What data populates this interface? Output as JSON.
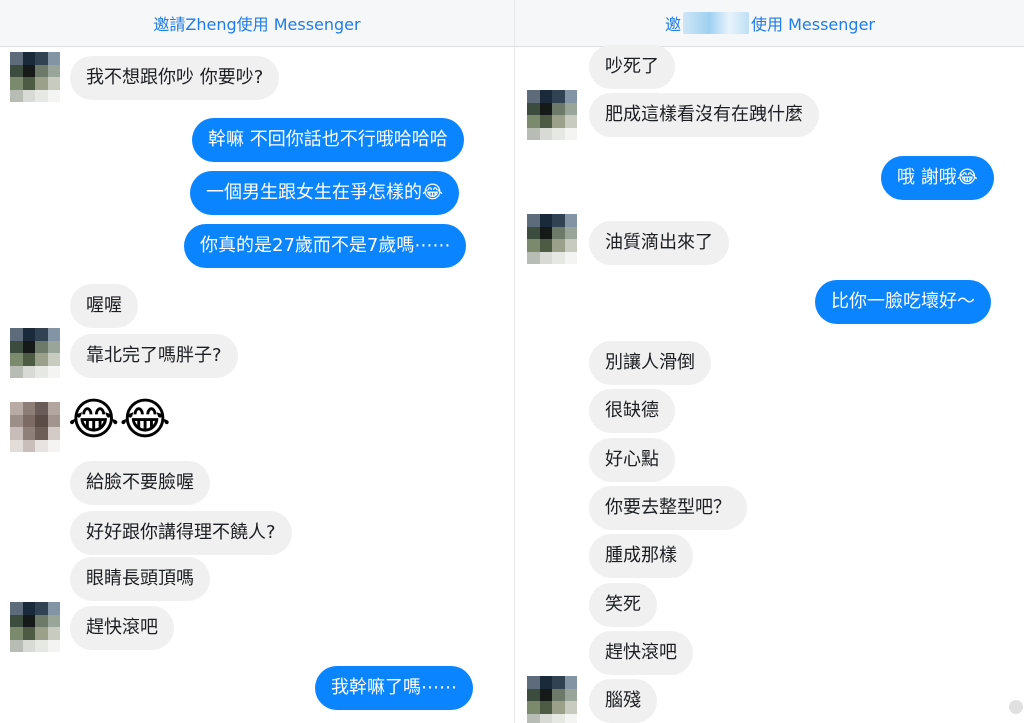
{
  "left": {
    "header": "邀請Zheng使用 Messenger",
    "messages": [
      {
        "text": "我不想跟你吵  你要吵?"
      },
      {
        "text": "幹嘛 不回你話也不行哦哈哈哈"
      },
      {
        "text": "一個男生跟女生在爭怎樣的😂"
      },
      {
        "text": "你真的是27歲而不是7歲嗎⋯⋯"
      },
      {
        "text": "喔喔"
      },
      {
        "text": "靠北完了嗎胖子?"
      },
      {
        "text": "😂😂"
      },
      {
        "text": "給臉不要臉喔"
      },
      {
        "text": "好好跟你講得理不饒人?"
      },
      {
        "text": "眼睛長頭頂嗎"
      },
      {
        "text": "趕快滾吧"
      },
      {
        "text": "我幹嘛了嗎⋯⋯"
      }
    ]
  },
  "right": {
    "header_prefix": "邀",
    "header_suffix": "使用 Messenger",
    "messages": [
      {
        "text": "吵死了"
      },
      {
        "text": "肥成這樣看沒有在跩什麼"
      },
      {
        "text": "哦 謝哦😂"
      },
      {
        "text": "油質滴出來了"
      },
      {
        "text": "比你一臉吃壞好～"
      },
      {
        "text": "別讓人滑倒"
      },
      {
        "text": "很缺德"
      },
      {
        "text": "好心點"
      },
      {
        "text": "你要去整型吧？"
      },
      {
        "text": "腫成那樣"
      },
      {
        "text": "笑死"
      },
      {
        "text": "趕快滾吧"
      },
      {
        "text": "腦殘"
      }
    ]
  },
  "colors": {
    "outgoing": "#0a84ff",
    "incoming": "#f1f0f0",
    "header_text": "#1f7ce6"
  }
}
